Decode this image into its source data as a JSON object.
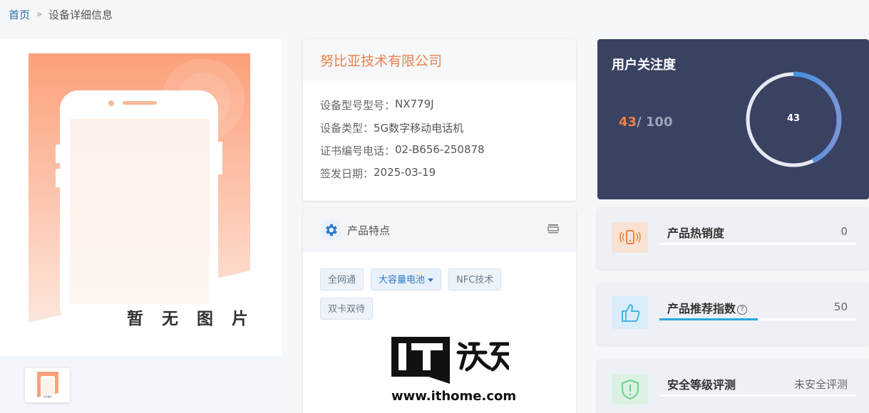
{
  "breadcrumb": {
    "home": "首页",
    "separator": "»",
    "current": "设备详细信息"
  },
  "image_panel": {
    "placeholder_text": "暂 无 图 片",
    "thumbnail_text": "暂无图片"
  },
  "company": {
    "name": "努比亚技术有限公司",
    "fields": [
      {
        "label": "设备型号型号：",
        "value": "NX779J"
      },
      {
        "label": "设备类型：",
        "value": "5G数字移动电话机"
      },
      {
        "label": "证书编号电话：",
        "value": "02-B656-250878"
      },
      {
        "label": "签发日期：",
        "value": "2025-03-19"
      }
    ]
  },
  "features": {
    "title": "产品特点",
    "tags": [
      {
        "label": "全网通",
        "active": false
      },
      {
        "label": "大容量电池",
        "active": true
      },
      {
        "label": "NFC技术",
        "active": false
      },
      {
        "label": "双卡双待",
        "active": false
      }
    ]
  },
  "attention": {
    "title": "用户关注度",
    "score": "43",
    "total": "/ 100",
    "ring_label": "43",
    "fraction": 0.43
  },
  "metrics": [
    {
      "label": "产品热销度",
      "value": "0",
      "fraction": 0,
      "icon": "phone-vibrate-icon"
    },
    {
      "label": "产品推荐指数",
      "value": "50",
      "fraction": 0.5,
      "icon": "thumbs-up-icon"
    },
    {
      "label": "安全等级评测",
      "value": "未安全评测",
      "fraction": 0,
      "icon": "shield-alert-icon"
    }
  ],
  "watermark": {
    "logo_text": "IT之家",
    "url": "www.ithome.com"
  },
  "colors": {
    "accent_orange": "#e7834e",
    "attention_bg": "#3a4262",
    "bar_blue": "#2aa6e0"
  }
}
